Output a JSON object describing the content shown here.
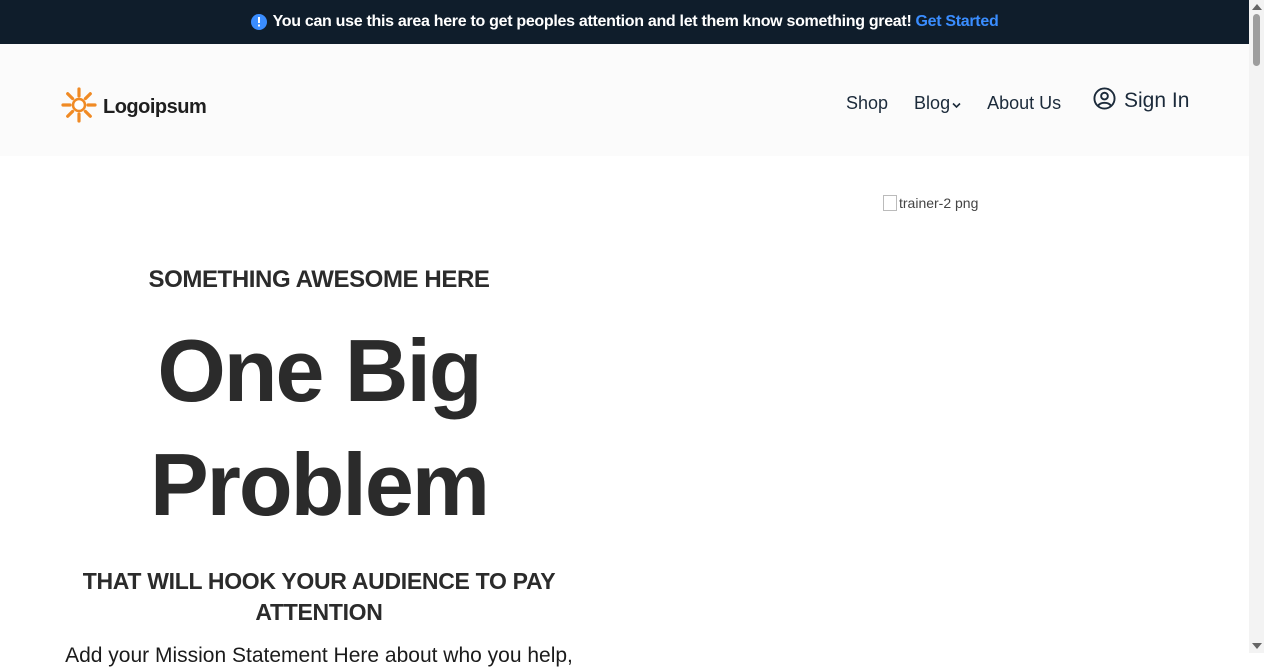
{
  "announcement": {
    "text": "You can use this area here to get peoples attention and let them know something great!",
    "cta": "Get Started",
    "icon": "info-icon"
  },
  "header": {
    "logo_text": "Logoipsum",
    "logo_icon": "sun-logo-icon",
    "nav": [
      {
        "label": "Shop"
      },
      {
        "label": "Blog"
      },
      {
        "label": "About Us"
      }
    ],
    "signin_label": "Sign In"
  },
  "hero": {
    "image_alt": "trainer-2 png",
    "eyebrow": "SOMETHING AWESOME HERE",
    "headline_line1": "One Big",
    "headline_line2": "Problem",
    "subhead": "THAT WILL HOOK YOUR AUDIENCE TO PAY ATTENTION",
    "mission": "Add your Mission Statement Here about who you help,"
  },
  "colors": {
    "announce_bg": "#0f1d2b",
    "accent": "#3a8dff",
    "logo_orange": "#f08a24"
  }
}
